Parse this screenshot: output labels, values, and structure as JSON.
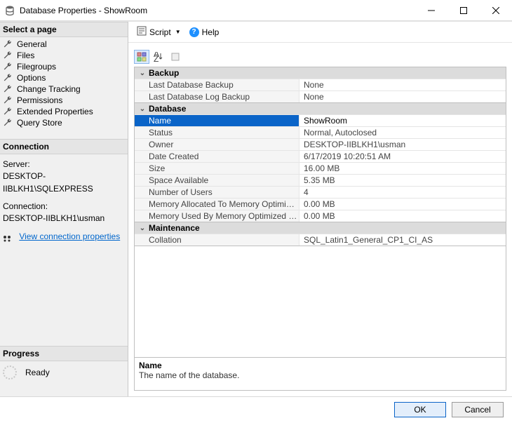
{
  "window": {
    "title": "Database Properties - ShowRoom"
  },
  "toolbar": {
    "script_label": "Script",
    "help_label": "Help"
  },
  "left": {
    "select_header": "Select a page",
    "pages": [
      "General",
      "Files",
      "Filegroups",
      "Options",
      "Change Tracking",
      "Permissions",
      "Extended Properties",
      "Query Store"
    ],
    "connection_header": "Connection",
    "server_label": "Server:",
    "server_value": "DESKTOP-IIBLKH1\\SQLEXPRESS",
    "connection_label": "Connection:",
    "connection_value": "DESKTOP-IIBLKH1\\usman",
    "view_conn_link": "View connection properties",
    "progress_header": "Progress",
    "progress_status": "Ready"
  },
  "grid": {
    "categories": [
      {
        "name": "Backup",
        "rows": [
          {
            "k": "Last Database Backup",
            "v": "None"
          },
          {
            "k": "Last Database Log Backup",
            "v": "None"
          }
        ]
      },
      {
        "name": "Database",
        "rows": [
          {
            "k": "Name",
            "v": "ShowRoom",
            "selected": true
          },
          {
            "k": "Status",
            "v": "Normal, Autoclosed"
          },
          {
            "k": "Owner",
            "v": "DESKTOP-IIBLKH1\\usman"
          },
          {
            "k": "Date Created",
            "v": "6/17/2019 10:20:51 AM"
          },
          {
            "k": "Size",
            "v": "16.00 MB"
          },
          {
            "k": "Space Available",
            "v": "5.35 MB"
          },
          {
            "k": "Number of Users",
            "v": "4"
          },
          {
            "k": "Memory Allocated To Memory Optimized Objects",
            "v": "0.00 MB"
          },
          {
            "k": "Memory Used By Memory Optimized Objects",
            "v": "0.00 MB"
          }
        ]
      },
      {
        "name": "Maintenance",
        "rows": [
          {
            "k": "Collation",
            "v": "SQL_Latin1_General_CP1_CI_AS"
          }
        ]
      }
    ],
    "doc_name": "Name",
    "doc_desc": "The name of the database."
  },
  "buttons": {
    "ok": "OK",
    "cancel": "Cancel"
  }
}
